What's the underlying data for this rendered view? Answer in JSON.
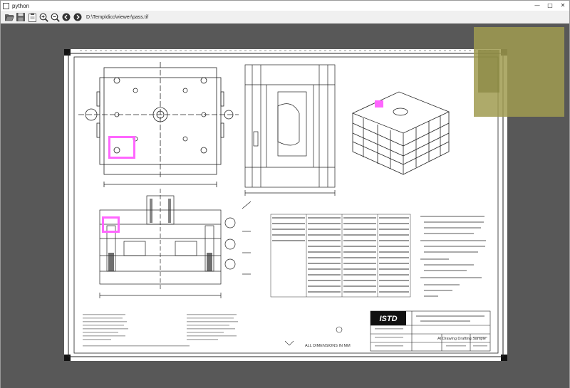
{
  "window": {
    "title": "python"
  },
  "toolbar": {
    "path": "D:\\Temp\\dico\\viewer\\pass.tif",
    "icons": [
      "folder-open-icon",
      "save-icon",
      "clipboard-icon",
      "zoom-in-icon",
      "zoom-out-icon",
      "back-icon",
      "forward-icon"
    ]
  },
  "drawing": {
    "logo": "ISTD",
    "footer_note": "ALL DIMENSIONS IN MM",
    "title_caption": "AI Drawing Drafting Sample"
  },
  "colors": {
    "highlight": "#ff66ff",
    "viewer_bg": "#585858",
    "overview": "#a09b50"
  }
}
